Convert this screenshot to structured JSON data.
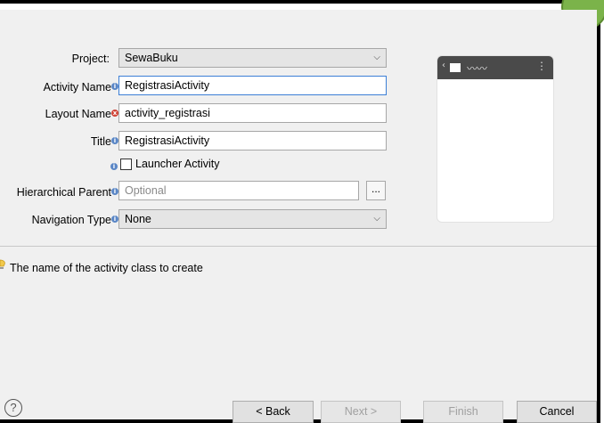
{
  "form": {
    "project_label": "Project:",
    "project_value": "SewaBuku",
    "activity_name_label": "Activity Name",
    "activity_name_value": "RegistrasiActivity",
    "layout_name_label": "Layout Name",
    "layout_name_value": "activity_registrasi",
    "title_label": "Title",
    "title_value": "RegistrasiActivity",
    "launcher_label": "Launcher Activity",
    "launcher_checked": false,
    "hierarchical_parent_label": "Hierarchical Parent",
    "hierarchical_parent_placeholder": "Optional",
    "browse_label": "...",
    "navigation_type_label": "Navigation Type",
    "navigation_type_value": "None"
  },
  "message": {
    "text": "The name of the activity class to create"
  },
  "buttons": {
    "help": "?",
    "back": "< Back",
    "next": "Next >",
    "finish": "Finish",
    "cancel": "Cancel"
  },
  "icons": {
    "info": "info-icon",
    "error": "error-icon",
    "dropdown": "chevron-down-icon",
    "hint": "lightbulb-icon"
  },
  "colors": {
    "info": "#5b87c6",
    "error": "#d04437",
    "focus_border": "#3c7fd6",
    "preview_actionbar": "#4a4a4a"
  }
}
